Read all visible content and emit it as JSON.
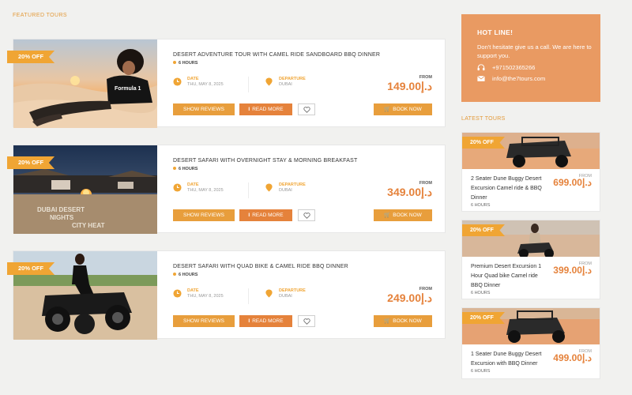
{
  "featured_title": "FEATURED TOURS",
  "tours": [
    {
      "badge": "20% OFF",
      "title": "DESERT ADVENTURE TOUR WITH CAMEL RIDE SANDBOARD BBQ DINNER",
      "duration": "6 HOURS",
      "date_label": "DATE",
      "date_value": "THU, MAY 8, 2025",
      "departure_label": "DEPARTURE",
      "departure_value": "DUBAI",
      "from_label": "FROM",
      "price": "149.00د.إ",
      "reviews_label": "SHOW REVIEWS",
      "readmore_label": "READ MORE",
      "book_label": "BOOK NOW"
    },
    {
      "badge": "20% OFF",
      "title": "DESERT SAFARI WITH OVERNIGHT STAY & MORNING BREAKFAST",
      "duration": "6 HOURS",
      "date_label": "DATE",
      "date_value": "THU, MAY 8, 2025",
      "departure_label": "DEPARTURE",
      "departure_value": "DUBAI",
      "from_label": "FROM",
      "price": "349.00د.إ",
      "reviews_label": "SHOW REVIEWS",
      "readmore_label": "READ MORE",
      "book_label": "BOOK NOW"
    },
    {
      "badge": "20% OFF",
      "title": "DESERT SAFARI WITH QUAD BIKE & CAMEL RIDE BBQ DINNER",
      "duration": "6 HOURS",
      "date_label": "DATE",
      "date_value": "THU, MAY 8, 2025",
      "departure_label": "DEPARTURE",
      "departure_value": "DUBAI",
      "from_label": "FROM",
      "price": "249.00د.إ",
      "reviews_label": "SHOW REVIEWS",
      "readmore_label": "READ MORE",
      "book_label": "BOOK NOW"
    }
  ],
  "image_texts": {
    "shirt": "Formula 1",
    "sand_1": "DUBAI DESERT",
    "sand_2": "NIGHTS",
    "sand_3": "CITY HEAT"
  },
  "hotline": {
    "title": "HOT LINE!",
    "text": "Don't hesitate give us a call. We are here to support you.",
    "phone": "+971502365266",
    "email": "info@the7tours.com"
  },
  "latest_title": "LATEST TOURS",
  "latest": [
    {
      "badge": "20% OFF",
      "name": "2 Seater Dune Buggy Desert Excursion Camel ride & BBQ Dinner",
      "from_label": "FROM",
      "price": "699.00د.إ",
      "duration": "6 HOURS"
    },
    {
      "badge": "20% OFF",
      "name": "Premium Desert Excursion 1 Hour Quad bike Camel ride BBQ Dinner",
      "from_label": "FROM",
      "price": "399.00د.إ",
      "duration": "6 HOURS"
    },
    {
      "badge": "20% OFF",
      "name": "1 Seater Dune Buggy Desert Excursion with BBQ Dinner",
      "from_label": "FROM",
      "price": "499.00د.إ",
      "duration": "6 HOURS"
    }
  ],
  "colors": {
    "accent_orange": "#e89e3c",
    "price_orange": "#e5823b",
    "hotline_bg": "#e99a62"
  }
}
